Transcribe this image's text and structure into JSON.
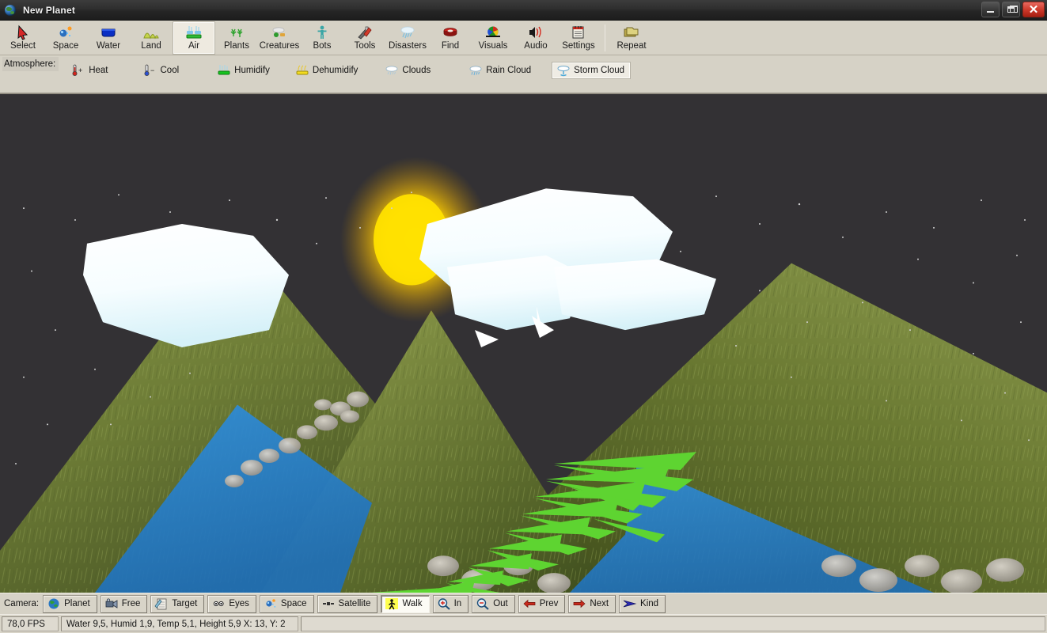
{
  "window": {
    "title": "New Planet",
    "icon": "globe-icon",
    "controls": {
      "minimize": "minimize-button",
      "restore": "restore-button",
      "close": "close-button"
    }
  },
  "main_toolbar": {
    "items": [
      {
        "label": "Select",
        "icon": "cursor-arrow-icon",
        "selected": false
      },
      {
        "label": "Space",
        "icon": "comet-icon",
        "selected": false
      },
      {
        "label": "Water",
        "icon": "water-tray-icon",
        "selected": false
      },
      {
        "label": "Land",
        "icon": "hills-icon",
        "selected": false
      },
      {
        "label": "Air",
        "icon": "air-sprinkler-icon",
        "selected": true
      },
      {
        "label": "Plants",
        "icon": "trees-icon",
        "selected": false
      },
      {
        "label": "Creatures",
        "icon": "creature-icon",
        "selected": false
      },
      {
        "label": "Bots",
        "icon": "robot-icon",
        "selected": false
      },
      {
        "label": "Tools",
        "icon": "tools-icon",
        "selected": false
      },
      {
        "label": "Disasters",
        "icon": "storm-icon",
        "selected": false
      },
      {
        "label": "Find",
        "icon": "magnify-book-icon",
        "selected": false
      },
      {
        "label": "Visuals",
        "icon": "color-wheel-icon",
        "selected": false
      },
      {
        "label": "Audio",
        "icon": "speaker-icon",
        "selected": false
      },
      {
        "label": "Settings",
        "icon": "notebook-icon",
        "selected": false
      },
      {
        "label": "Repeat",
        "icon": "stack-folder-icon",
        "selected": false,
        "separator_before": true
      }
    ]
  },
  "sub_toolbar": {
    "group_label": "Atmosphere:",
    "items": [
      {
        "label": "Heat",
        "icon": "thermometer-plus-icon",
        "selected": false
      },
      {
        "label": "Cool",
        "icon": "thermometer-minus-icon",
        "selected": false
      },
      {
        "label": "Humidify",
        "icon": "humidifier-icon",
        "selected": false
      },
      {
        "label": "Dehumidify",
        "icon": "dehumidifier-icon",
        "selected": false
      },
      {
        "label": "Clouds",
        "icon": "cloud-icon",
        "selected": false
      },
      {
        "label": "Rain Cloud",
        "icon": "rain-cloud-icon",
        "selected": false
      },
      {
        "label": "Storm Cloud",
        "icon": "storm-cloud-icon",
        "selected": true
      }
    ]
  },
  "camera_bar": {
    "group_label": "Camera:",
    "items": [
      {
        "label": "Planet",
        "icon": "globe-icon",
        "selected": false
      },
      {
        "label": "Free",
        "icon": "camcorder-icon",
        "selected": false
      },
      {
        "label": "Target",
        "icon": "target-page-icon",
        "selected": false
      },
      {
        "label": "Eyes",
        "icon": "eyes-icon",
        "selected": false
      },
      {
        "label": "Space",
        "icon": "comet-icon",
        "selected": false
      },
      {
        "label": "Satellite",
        "icon": "satellite-icon",
        "selected": false
      },
      {
        "label": "Walk",
        "icon": "walking-man-icon",
        "selected": true
      },
      {
        "label": "In",
        "icon": "zoom-in-icon",
        "selected": false
      },
      {
        "label": "Out",
        "icon": "zoom-out-icon",
        "selected": false
      },
      {
        "label": "Prev",
        "icon": "arrow-left-icon",
        "selected": false
      },
      {
        "label": "Next",
        "icon": "arrow-right-icon",
        "selected": false
      },
      {
        "label": "Kind",
        "icon": "arrow-kind-icon",
        "selected": false
      }
    ]
  },
  "status_bar": {
    "fps": "78,0 FPS",
    "info": "Water 9,5, Humid 1,9, Temp 5,1, Height 5,9 X: 13, Y: 2",
    "extra": ""
  },
  "viewport": {
    "name": "3d-planet-viewport",
    "sky_color": "#333134",
    "colors": {
      "grass_light": "#8f9a4e",
      "grass_dark": "#4e5c2a",
      "water": "#2f8ddb",
      "cloud": "#f2fbfd",
      "sun_glow": "#ffd400",
      "plant_green": "#5ed431",
      "rock": "#b9b4ab"
    },
    "objects": [
      {
        "type": "cloud",
        "name": "cloud-left"
      },
      {
        "type": "cloud",
        "name": "cloud-cluster-top"
      },
      {
        "type": "cloud",
        "name": "cloud-right"
      },
      {
        "type": "mountain",
        "name": "mountain-left"
      },
      {
        "type": "mountain",
        "name": "mountain-center"
      },
      {
        "type": "mountain",
        "name": "mountain-right"
      },
      {
        "type": "sun-glow",
        "name": "sun-glow"
      },
      {
        "type": "river",
        "name": "river-left"
      },
      {
        "type": "river",
        "name": "river-right"
      },
      {
        "type": "plant",
        "name": "fern-plant"
      },
      {
        "type": "rocks",
        "name": "rock-cluster"
      }
    ]
  }
}
